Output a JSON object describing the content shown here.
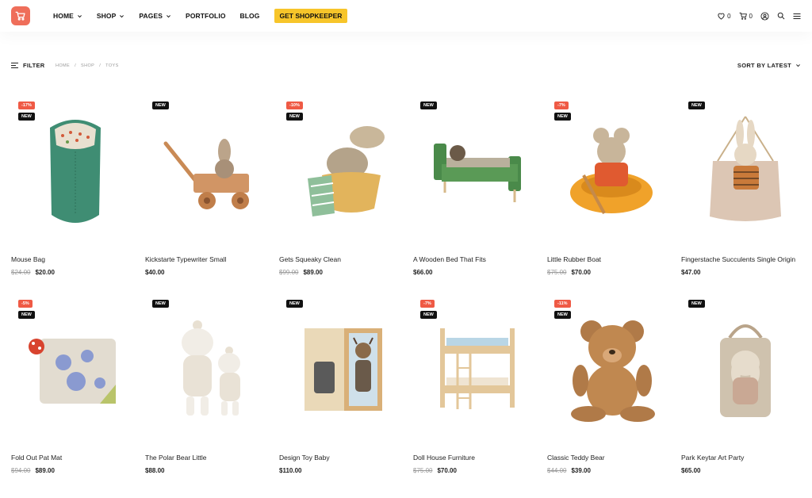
{
  "header": {
    "logo_icon": "shopping-cart-icon",
    "nav": [
      {
        "label": "HOME",
        "has_dropdown": true
      },
      {
        "label": "SHOP",
        "has_dropdown": true
      },
      {
        "label": "PAGES",
        "has_dropdown": true
      },
      {
        "label": "PORTFOLIO",
        "has_dropdown": false
      },
      {
        "label": "BLOG",
        "has_dropdown": false
      }
    ],
    "cta_label": "GET SHOPKEEPER",
    "wishlist_count": "0",
    "cart_count": "0"
  },
  "toolbar": {
    "filter_label": "FILTER",
    "breadcrumb": [
      "HOME",
      "SHOP",
      "TOYS"
    ],
    "sort_label": "SORT BY LATEST"
  },
  "products": [
    {
      "name": "Mouse Bag",
      "old_price": "$24.00",
      "price": "$20.00",
      "badges": [
        "-17%",
        "NEW"
      ]
    },
    {
      "name": "Kickstarte Typewriter Small",
      "old_price": "",
      "price": "$40.00",
      "badges": [
        "NEW"
      ]
    },
    {
      "name": "Gets Squeaky Clean",
      "old_price": "$99.00",
      "price": "$89.00",
      "badges": [
        "-10%",
        "NEW"
      ]
    },
    {
      "name": "A Wooden Bed That Fits",
      "old_price": "",
      "price": "$66.00",
      "badges": [
        "NEW"
      ]
    },
    {
      "name": "Little Rubber Boat",
      "old_price": "$75.00",
      "price": "$70.00",
      "badges": [
        "-7%",
        "NEW"
      ]
    },
    {
      "name": "Fingerstache Succulents Single Origin",
      "old_price": "",
      "price": "$47.00",
      "badges": [
        "NEW"
      ]
    },
    {
      "name": "Fold Out Pat Mat",
      "old_price": "$94.00",
      "price": "$89.00",
      "badges": [
        "-5%",
        "NEW"
      ]
    },
    {
      "name": "The Polar Bear Little",
      "old_price": "",
      "price": "$88.00",
      "badges": [
        "NEW"
      ]
    },
    {
      "name": "Design Toy Baby",
      "old_price": "",
      "price": "$110.00",
      "badges": [
        "NEW"
      ]
    },
    {
      "name": "Doll House Furniture",
      "old_price": "$75.00",
      "price": "$70.00",
      "badges": [
        "-7%",
        "NEW"
      ]
    },
    {
      "name": "Classic Teddy Bear",
      "old_price": "$44.00",
      "price": "$39.00",
      "badges": [
        "-11%",
        "NEW"
      ]
    },
    {
      "name": "Park Keytar Art Party",
      "old_price": "",
      "price": "$65.00",
      "badges": [
        "NEW"
      ]
    }
  ],
  "colors": {
    "accent": "#ef6e5a",
    "cta": "#f7c52a",
    "sale_badge": "#ef5a45",
    "new_badge": "#111111"
  }
}
